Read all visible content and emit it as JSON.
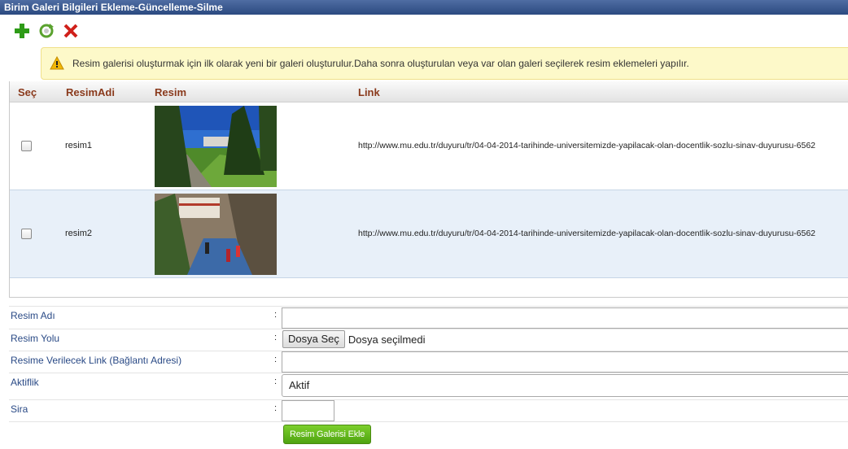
{
  "panel": {
    "title": "Birim Galeri Bilgileri Ekleme-Güncelleme-Silme"
  },
  "toolbar": {
    "icons": [
      "add-icon",
      "refresh-icon",
      "delete-icon"
    ]
  },
  "warning": {
    "text": "Resim galerisi oluşturmak için ilk olarak yeni bir galeri oluşturulur.Daha sonra oluşturulan veya var olan galeri seçilerek resim eklemeleri yapılır."
  },
  "grid": {
    "columns": [
      "Seç",
      "ResimAdi",
      "Resim",
      "Link"
    ],
    "rows": [
      {
        "name": "resim1",
        "link": "http://www.mu.edu.tr/duyuru/tr/04-04-2014-tarihinde-universitemizde-yapilacak-olan-docentlik-sozlu-sinav-duyurusu-6562",
        "checked": false
      },
      {
        "name": "resim2",
        "link": "http://www.mu.edu.tr/duyuru/tr/04-04-2014-tarihinde-universitemizde-yapilacak-olan-docentlik-sozlu-sinav-duyurusu-6562",
        "checked": false
      }
    ]
  },
  "form": {
    "resim_adi_label": "Resim Adı",
    "resim_yolu_label": "Resim Yolu",
    "link_label": "Resime Verilecek Link (Bağlantı Adresi)",
    "aktiflik_label": "Aktiflik",
    "sira_label": "Sira",
    "colon": ":",
    "file_button": "Dosya Seç",
    "file_status": "Dosya seçilmedi",
    "aktiflik_value": "Aktif",
    "resim_adi_value": "",
    "link_value": "",
    "sira_value": "",
    "submit_label": "Resim Galerisi Ekle"
  },
  "colors": {
    "title_bar": "#2b4a80",
    "header_text": "#8a3a1c",
    "label_text": "#2a4a86",
    "submit": "#4fa311",
    "warning_bg": "#fdf9c9"
  }
}
